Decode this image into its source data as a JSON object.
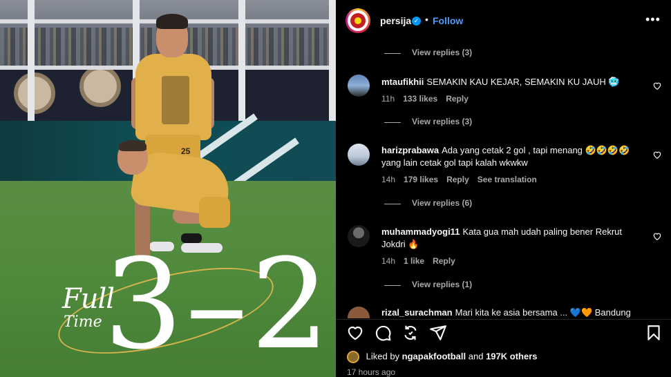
{
  "post_image": {
    "full_label": "Full",
    "time_label": "Time",
    "score": "3–2",
    "jersey_number": "25"
  },
  "header": {
    "username": "persija",
    "verified_mark": "✓",
    "separator": "•",
    "follow_label": "Follow",
    "more_label": "•••"
  },
  "view_replies": [
    "View replies (3)",
    "View replies (3)",
    "View replies (6)",
    "View replies (1)"
  ],
  "comments": [
    {
      "username": "mtaufikhii",
      "text": "SEMAKIN KAU KEJAR, SEMAKIN KU JAUH 🥶",
      "time": "11h",
      "likes": "133 likes",
      "reply": "Reply",
      "translate": ""
    },
    {
      "username": "harizprabawa",
      "text": "Ada yang cetak 2 gol , tapi menang 🤣🤣🤣🤣 yang lain cetak gol tapi kalah wkwkw",
      "time": "14h",
      "likes": "179 likes",
      "reply": "Reply",
      "translate": "See translation"
    },
    {
      "username": "muhammadyogi11",
      "text": "Kata gua mah udah paling bener Rekrut Jokdri 🔥",
      "time": "14h",
      "likes": "1 like",
      "reply": "Reply",
      "translate": ""
    },
    {
      "username": "rizal_surachman",
      "text": "Mari kita ke asia bersama ... 💙🧡 Bandung",
      "time": "",
      "likes": "",
      "reply": "",
      "translate": ""
    }
  ],
  "actions": {
    "like_icon": "heart-icon",
    "comment_icon": "comment-icon",
    "repost_icon": "repost-icon",
    "share_icon": "share-icon",
    "save_icon": "bookmark-icon"
  },
  "likes": {
    "prefix": "Liked by",
    "user": "ngapakfootball",
    "middle": "and",
    "others": "197K others"
  },
  "timestamp": "17 hours ago",
  "colors": {
    "background": "#000000",
    "link_blue": "#4a9dff",
    "muted": "#a8a8a8",
    "jersey_gold": "#e2b04a"
  }
}
